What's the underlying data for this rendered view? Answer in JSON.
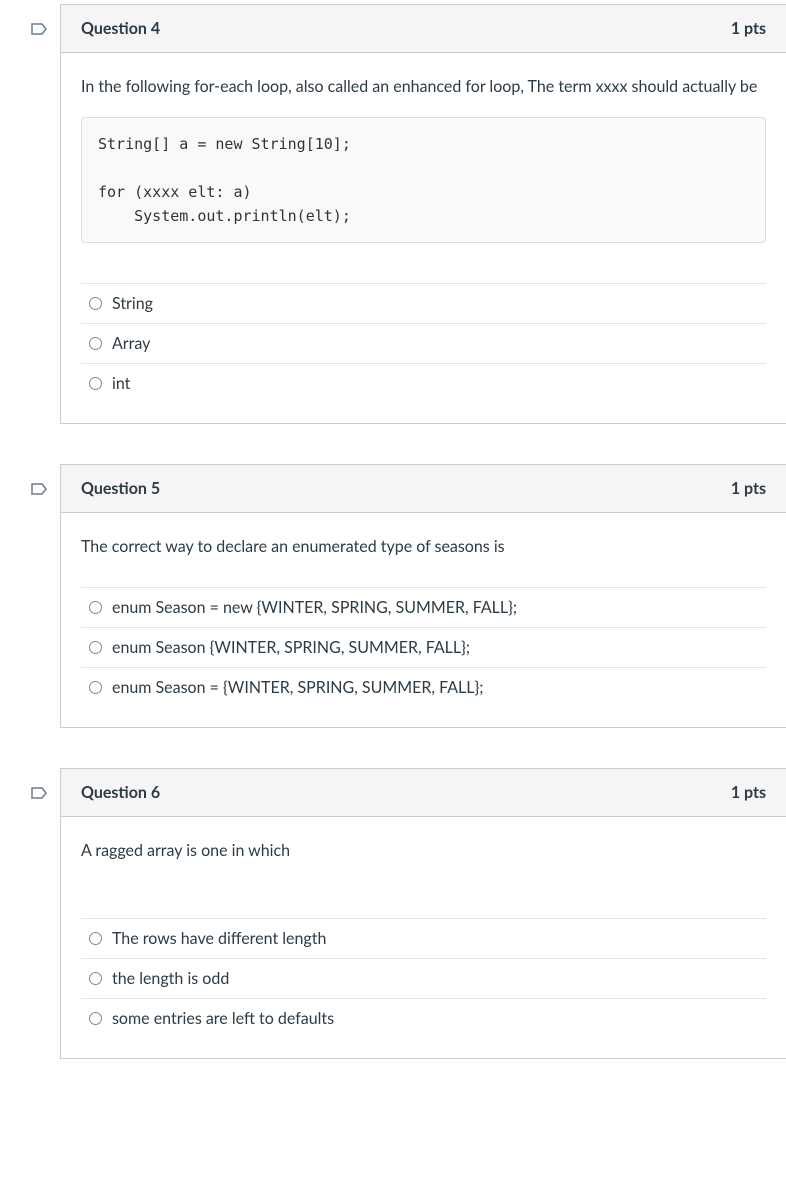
{
  "questions": [
    {
      "number": "Question 4",
      "points": "1 pts",
      "prompt": "In the following for-each loop, also called an enhanced for loop, The term xxxx should actually be",
      "code": "String[] a = new String[10];\n\nfor (xxxx elt: a)\n    System.out.println(elt);",
      "answers": [
        "String",
        "Array",
        "int"
      ]
    },
    {
      "number": "Question 5",
      "points": "1 pts",
      "prompt": "The correct way to declare an enumerated type of seasons is",
      "answers": [
        "enum Season = new {WINTER, SPRING, SUMMER, FALL};",
        "enum Season {WINTER, SPRING, SUMMER, FALL};",
        "enum Season = {WINTER, SPRING, SUMMER, FALL};"
      ]
    },
    {
      "number": "Question 6",
      "points": "1 pts",
      "prompt": "A ragged array is one in which",
      "answers": [
        "The rows have different length",
        "the length is odd",
        "some entries are left to defaults"
      ]
    }
  ]
}
